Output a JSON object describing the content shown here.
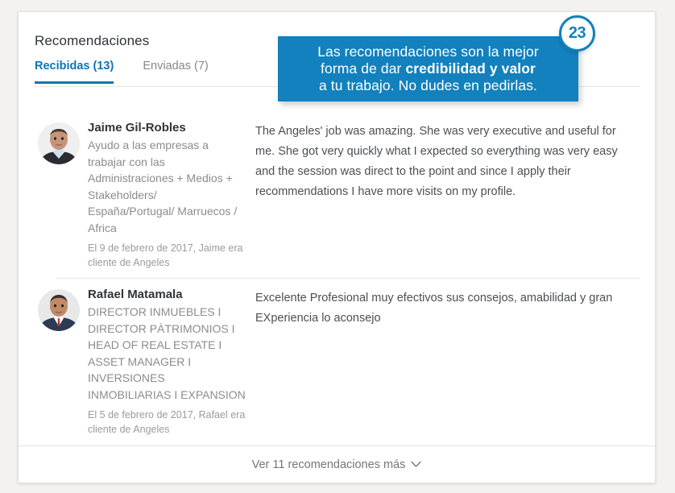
{
  "card": {
    "title": "Recomendaciones"
  },
  "tabs": [
    {
      "label": "Recibidas (13)",
      "active": true
    },
    {
      "label": "Enviadas (7)",
      "active": false
    }
  ],
  "callout": {
    "line1": "Las recomendaciones son la mejor",
    "line2_prefix": "forma de dar ",
    "line2_bold": "credibilidad y valor",
    "line3": "a tu trabajo. No dudes en pedirlas.",
    "badge": "23",
    "background_color": "#1281bd",
    "badge_text_color": "#1281bd"
  },
  "recommendations": [
    {
      "name": "Jaime Gil-Robles",
      "headline": "Ayudo a las empresas a trabajar con las Administraciones + Medios + Stakeholders/ España/Portugal/ Marruecos / Africa",
      "date": "El 9 de febrero de 2017, Jaime era cliente de Angeles",
      "body": "The Angeles' job was amazing. She was very executive and useful for me. She got very quickly what I expected so everything was very easy and the session was direct to the point and since I apply their recommendations I have more visits on my profile.",
      "avatar": "avatar-photo-male-1"
    },
    {
      "name": "Rafael Matamala",
      "headline": "DIRECTOR INMUEBLES I DIRECTOR PÀTRIMONIOS I HEAD OF REAL ESTATE I ASSET MANAGER I INVERSIONES INMOBILIARIAS I EXPANSION",
      "date": "El 5 de febrero de 2017, Rafael era cliente de Angeles",
      "body": "Excelente Profesional muy efectivos sus consejos, amabilidad y gran EXperiencia lo aconsejo",
      "avatar": "avatar-photo-male-2"
    }
  ],
  "footer": {
    "label": "Ver 11 recomendaciones más",
    "icon": "chevron-down-icon"
  },
  "colors": {
    "accent": "#0b76b7",
    "callout": "#1281bd",
    "page_background": "#f3f2f0",
    "card_background": "#ffffff",
    "text_primary": "#2f3438",
    "text_muted": "#8c8c8c"
  }
}
